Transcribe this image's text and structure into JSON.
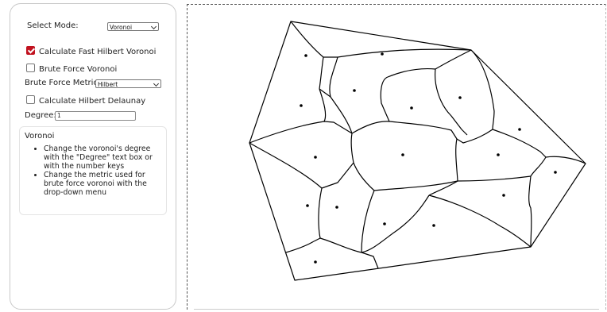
{
  "sidebar": {
    "select_mode_label": "Select Mode:",
    "select_mode_value": "Voronoi",
    "fast_hilbert_label": "Calculate Fast Hilbert Voronoi",
    "fast_hilbert_checked": true,
    "brute_force_label": "Brute Force Voronoi",
    "brute_force_checked": false,
    "metric_label": "Brute Force Metric:",
    "metric_value": "Hilbert",
    "delaunay_label": "Calculate Hilbert Delaunay",
    "delaunay_checked": false,
    "degree_label": "Degree:",
    "degree_value": "1",
    "accent_color": "#c1121f"
  },
  "info": {
    "title": "Voronoi",
    "items": [
      "Change the voronoi's degree with the \"Degree\" text box or with the number keys",
      "Change the metric used for brute force voronoi with the drop-down menu"
    ]
  }
}
